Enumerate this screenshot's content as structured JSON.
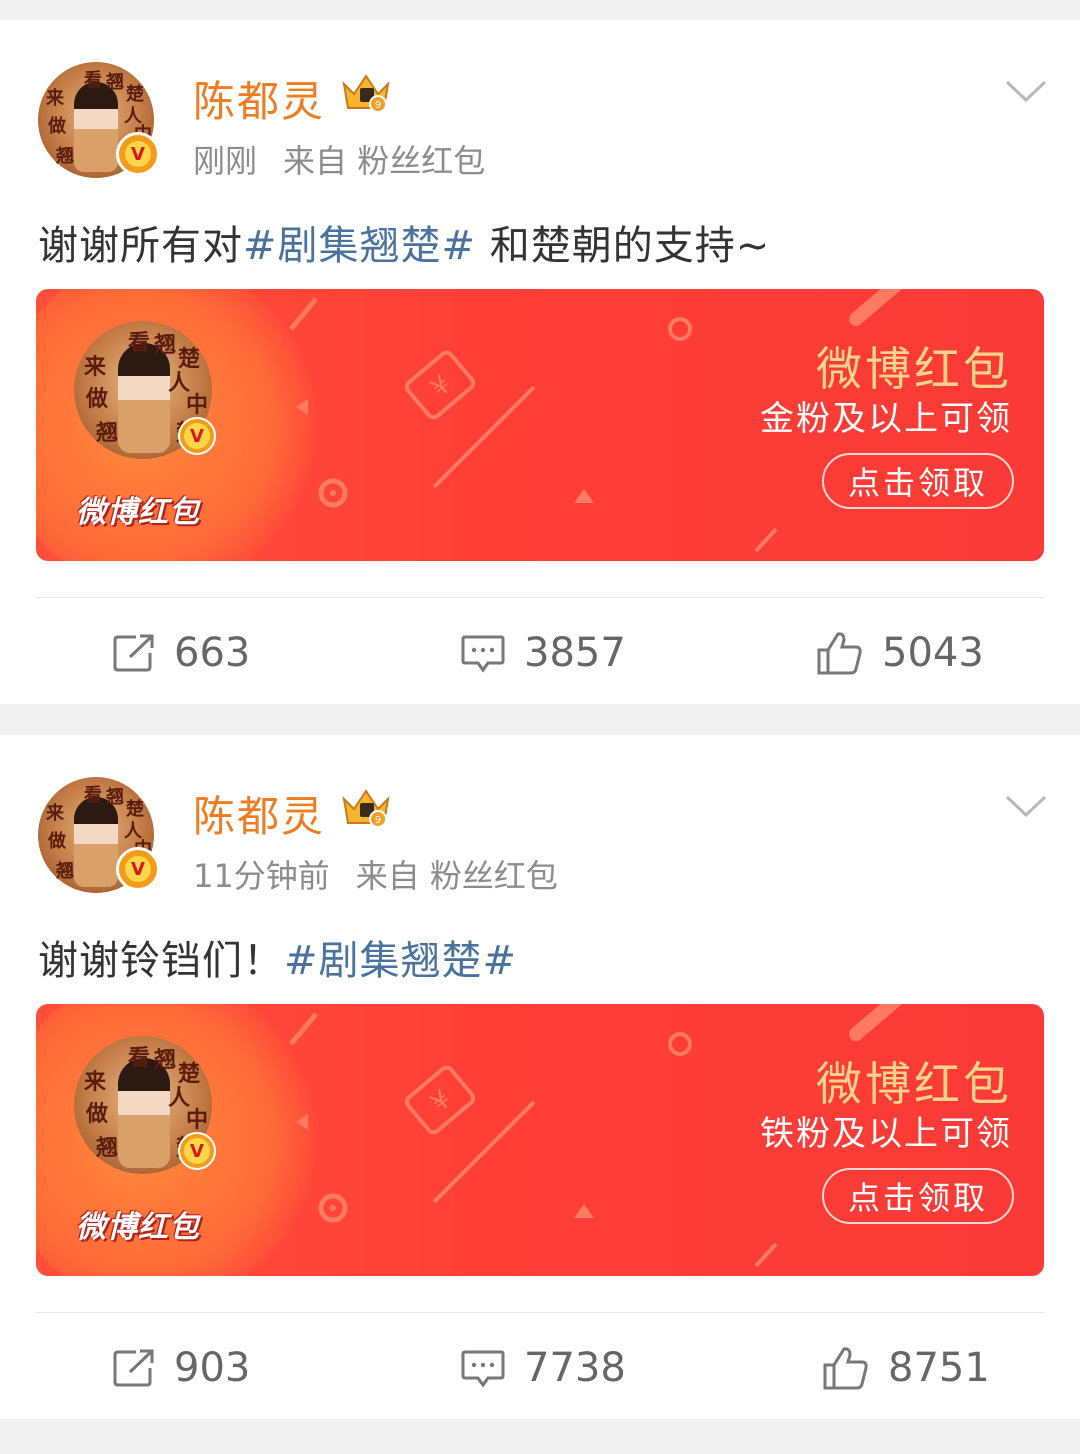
{
  "posts": [
    {
      "username": "陈都灵",
      "time": "刚刚",
      "source": "来自 粉丝红包",
      "text_before": "谢谢所有对",
      "hashtag": "#剧集翘楚#",
      "text_after": " 和楚朝的支持~",
      "card": {
        "brand": "微博红包",
        "title": "微博红包",
        "subtitle": "金粉及以上可领",
        "button": "点击领取"
      },
      "reposts": "663",
      "comments": "3857",
      "likes": "5043"
    },
    {
      "username": "陈都灵",
      "time": "11分钟前",
      "source": "来自 粉丝红包",
      "text_before": "谢谢铃铛们！",
      "hashtag": "#剧集翘楚#",
      "text_after": "",
      "card": {
        "brand": "微博红包",
        "title": "微博红包",
        "subtitle": "铁粉及以上可领",
        "button": "点击领取"
      },
      "reposts": "903",
      "comments": "7738",
      "likes": "8751"
    }
  ],
  "avatar_text": [
    "来",
    "看",
    "翘",
    "楚",
    "做",
    "人",
    "中",
    "翘",
    "楚"
  ],
  "icons": {
    "verified": "v-badge-icon",
    "crown": "crown-icon",
    "more": "chevron-down-icon",
    "repost": "repost-icon",
    "comment": "comment-icon",
    "like": "like-icon"
  },
  "colors": {
    "username": "#f07c21",
    "hashtag": "#49729e",
    "card_red": "#ff3e36",
    "card_title": "#ffd48a"
  }
}
